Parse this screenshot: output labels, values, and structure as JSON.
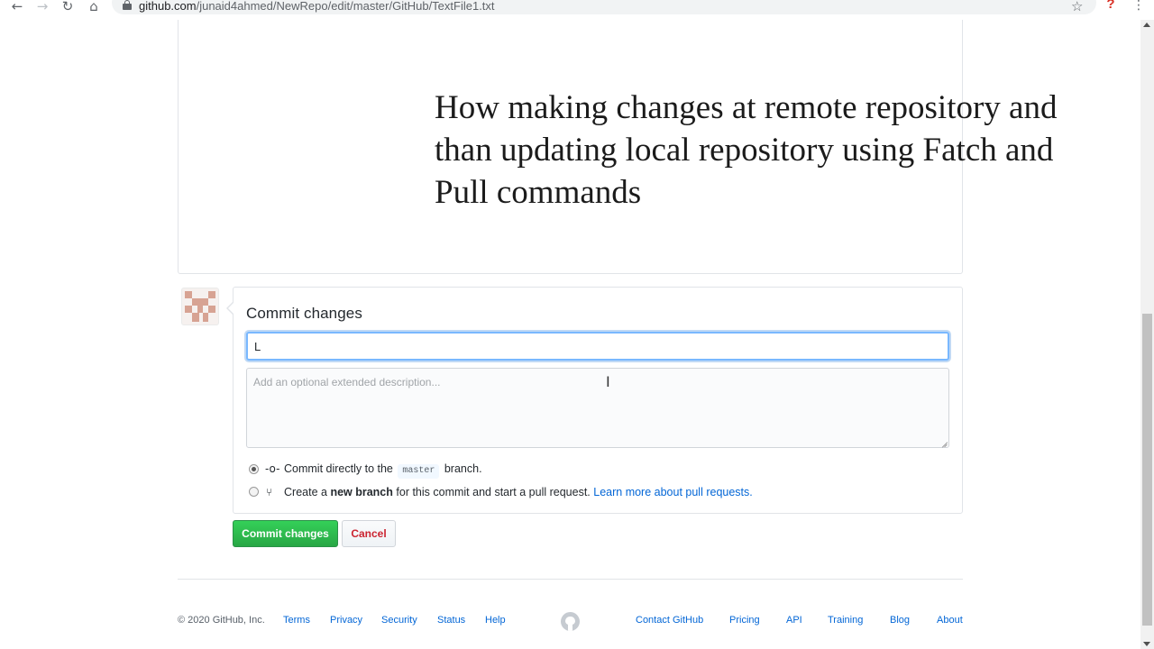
{
  "browser": {
    "url_host": "github.com",
    "url_path": "/junaid4ahmed/NewRepo/edit/master/GitHub/TextFile1.txt"
  },
  "editor": {
    "content": "How making changes at remote repository and than updating local repository using Fatch and Pull commands"
  },
  "commit": {
    "title": "Commit changes",
    "summary_value": "L",
    "description_placeholder": "Add an optional extended description...",
    "option_direct": {
      "text_before": "Commit directly to the",
      "branch": "master",
      "text_after": "branch."
    },
    "option_new_branch": {
      "text_before": "Create a",
      "bold": "new branch",
      "text_after": "for this commit and start a pull request.",
      "link": "Learn more about pull requests."
    },
    "submit_label": "Commit changes",
    "cancel_label": "Cancel"
  },
  "footer": {
    "copyright": "© 2020 GitHub, Inc.",
    "left_links": [
      "Terms",
      "Privacy",
      "Security",
      "Status",
      "Help"
    ],
    "right_links": [
      "Contact GitHub",
      "Pricing",
      "API",
      "Training",
      "Blog",
      "About"
    ]
  },
  "colors": {
    "primary_button": "#28a745",
    "link": "#0366d6",
    "cancel": "#cb2431",
    "focus": "#79b8ff"
  }
}
